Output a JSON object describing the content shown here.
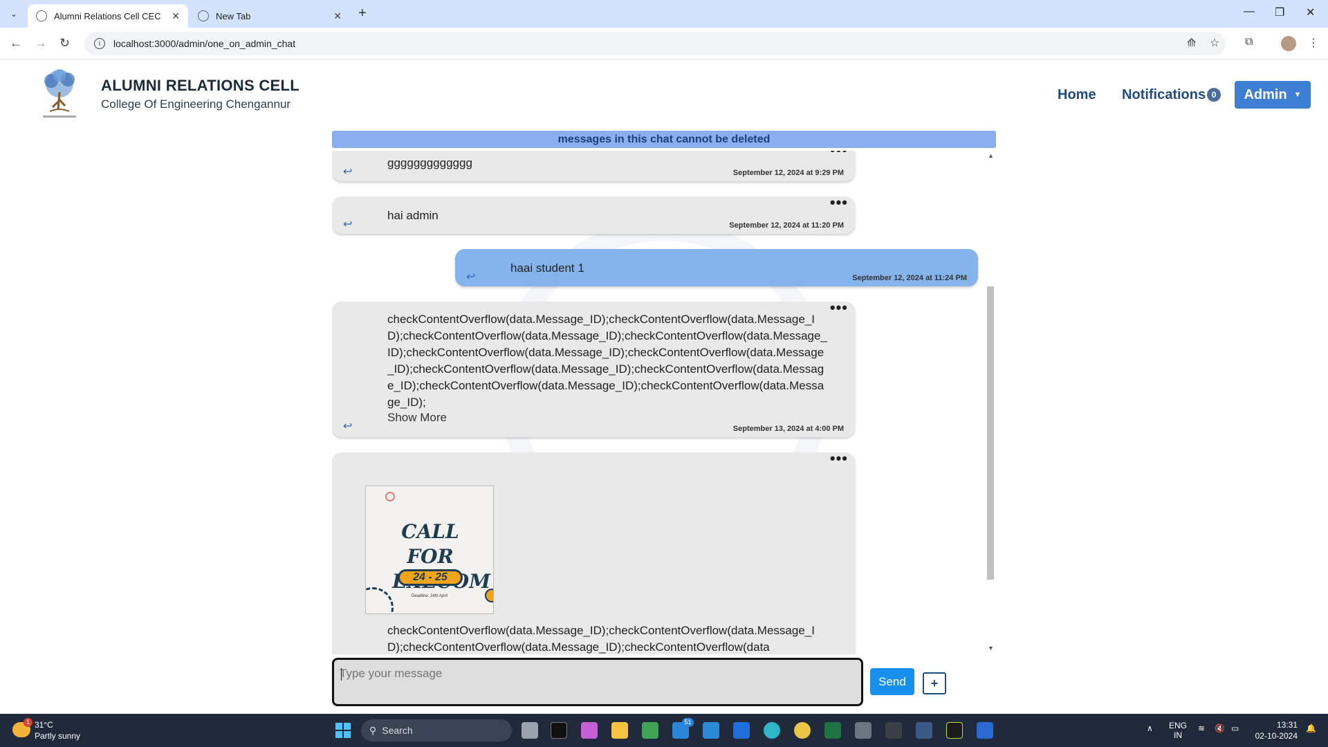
{
  "browser": {
    "tabs": [
      {
        "title": "Alumni Relations Cell CEC",
        "active": true
      },
      {
        "title": "New Tab",
        "active": false
      }
    ],
    "url": "localhost:3000/admin/one_on_admin_chat"
  },
  "header": {
    "title": "ALUMNI RELATIONS CELL",
    "subtitle": "College Of Engineering Chengannur",
    "nav": {
      "home": "Home",
      "notifications": "Notifications",
      "notifications_count": "0",
      "admin": "Admin"
    }
  },
  "chat": {
    "banner": "messages in this chat cannot be deleted",
    "messages": [
      {
        "text": "ggggggggggggg",
        "time": "September 12, 2024 at 9:29 PM",
        "own": false
      },
      {
        "text": "hai admin",
        "time": "September 12, 2024 at 11:20 PM",
        "own": false
      },
      {
        "text": "haai student 1",
        "time": "September 12, 2024 at 11:24 PM",
        "own": true
      },
      {
        "text": "checkContentOverflow(data.Message_ID);checkContentOverflow(data.Message_ID);checkContentOverflow(data.Message_ID);checkContentOverflow(data.Message_ID);checkContentOverflow(data.Message_ID);checkContentOverflow(data.Message_ID);checkContentOverflow(data.Message_ID);checkContentOverflow(data.Message_ID);checkContentOverflow(data.Message_ID);checkContentOverflow(data.Message_ID);",
        "show_more": "Show More",
        "time": "September 13, 2024 at 4:00 PM",
        "own": false
      },
      {
        "poster_title": "CALL FOR EXECOM",
        "poster_year": "24 - 25",
        "poster_deadline": "Deadline: 24th April",
        "text": "checkContentOverflow(data.Message_ID);checkContentOverflow(data.Message_ID);checkContentOverflow(data.Message_ID);checkContentOverflow(data",
        "own": false
      }
    ],
    "composer_placeholder": "Type your message",
    "send_label": "Send",
    "attach_label": "+"
  },
  "taskbar": {
    "weather_temp": "31°C",
    "weather_cond": "Partly sunny",
    "weather_badge": "1",
    "search_label": "Search",
    "mail_badge": "51",
    "lang_top": "ENG",
    "lang_bottom": "IN",
    "time": "13:31",
    "date": "02-10-2024"
  },
  "colors": {
    "banner": "#8aaef0",
    "own_message": "#85b4ec",
    "other_message": "#e9e9e9",
    "admin_button": "#3e7fd6",
    "send_button": "#1a90ee"
  }
}
